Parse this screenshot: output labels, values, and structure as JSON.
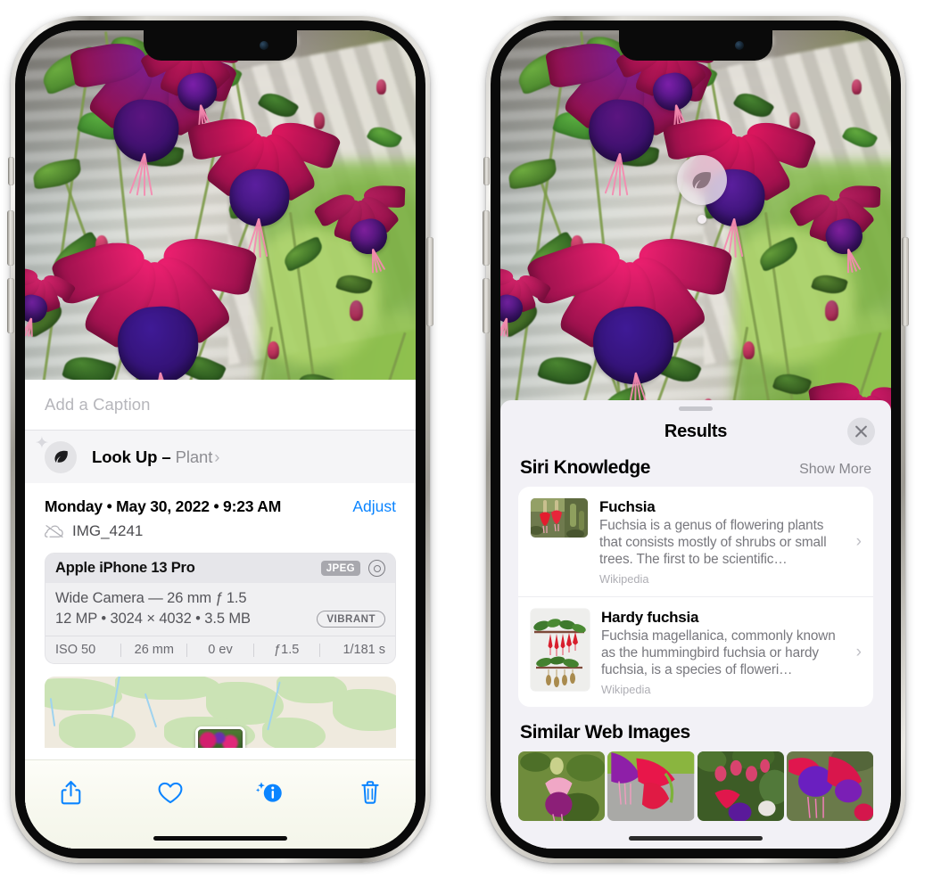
{
  "left_phone": {
    "name": "Photos — photo info",
    "caption": {
      "placeholder": "Add a Caption",
      "value": ""
    },
    "lookup": {
      "label": "Look Up",
      "dash": "–",
      "subject": "Plant",
      "chevron": "›",
      "icon": "leaf-icon"
    },
    "meta": {
      "date": "Monday • May 30, 2022 • 9:23 AM",
      "adjust_label": "Adjust",
      "filename": "IMG_4241",
      "cloud_icon": "cloud-slash-icon"
    },
    "exif": {
      "model": "Apple iPhone 13 Pro",
      "format_badge": "JPEG",
      "aperture_icon": "aperture-icon",
      "lens": "Wide Camera — 26 mm ƒ 1.5",
      "dimensions": "12 MP • 3024 × 4032 • 3.5 MB",
      "profile_badge": "VIBRANT",
      "stats": [
        "ISO 50",
        "26 mm",
        "0 ev",
        "ƒ1.5",
        "1/181 s"
      ]
    },
    "toolbar": [
      {
        "name": "share-button",
        "icon": "share-icon",
        "label": "Share"
      },
      {
        "name": "favorite-button",
        "icon": "heart-icon",
        "label": "Favorite"
      },
      {
        "name": "info-button",
        "icon": "info-sparkle-icon",
        "label": "Info"
      },
      {
        "name": "delete-button",
        "icon": "trash-icon",
        "label": "Delete"
      }
    ]
  },
  "right_phone": {
    "name": "Visual Look Up results",
    "photo_badge": {
      "icon": "leaf-icon",
      "label": "Plant subject marker"
    },
    "sheet": {
      "title": "Results",
      "close_label": "×",
      "close_icon": "close-icon"
    },
    "siri_knowledge": {
      "heading": "Siri Knowledge",
      "show_more": "Show More",
      "items": [
        {
          "title": "Fuchsia",
          "description": "Fuchsia is a genus of flowering plants that consists mostly of shrubs or small trees. The first to be scientific…",
          "source": "Wikipedia",
          "chevron": "›"
        },
        {
          "title": "Hardy fuchsia",
          "description": "Fuchsia magellanica, commonly known as the hummingbird fuchsia or hardy fuchsia, is a species of floweri…",
          "source": "Wikipedia",
          "chevron": "›"
        }
      ]
    },
    "similar_web_images": {
      "heading": "Similar Web Images",
      "count": 4
    }
  },
  "colors": {
    "accent_blue": "#0a84ff",
    "sheet_background": "#f2f1f6",
    "card_background": "#ffffff",
    "secondary_text": "#8e8e93",
    "badge_gray": "#a8a8ae"
  }
}
